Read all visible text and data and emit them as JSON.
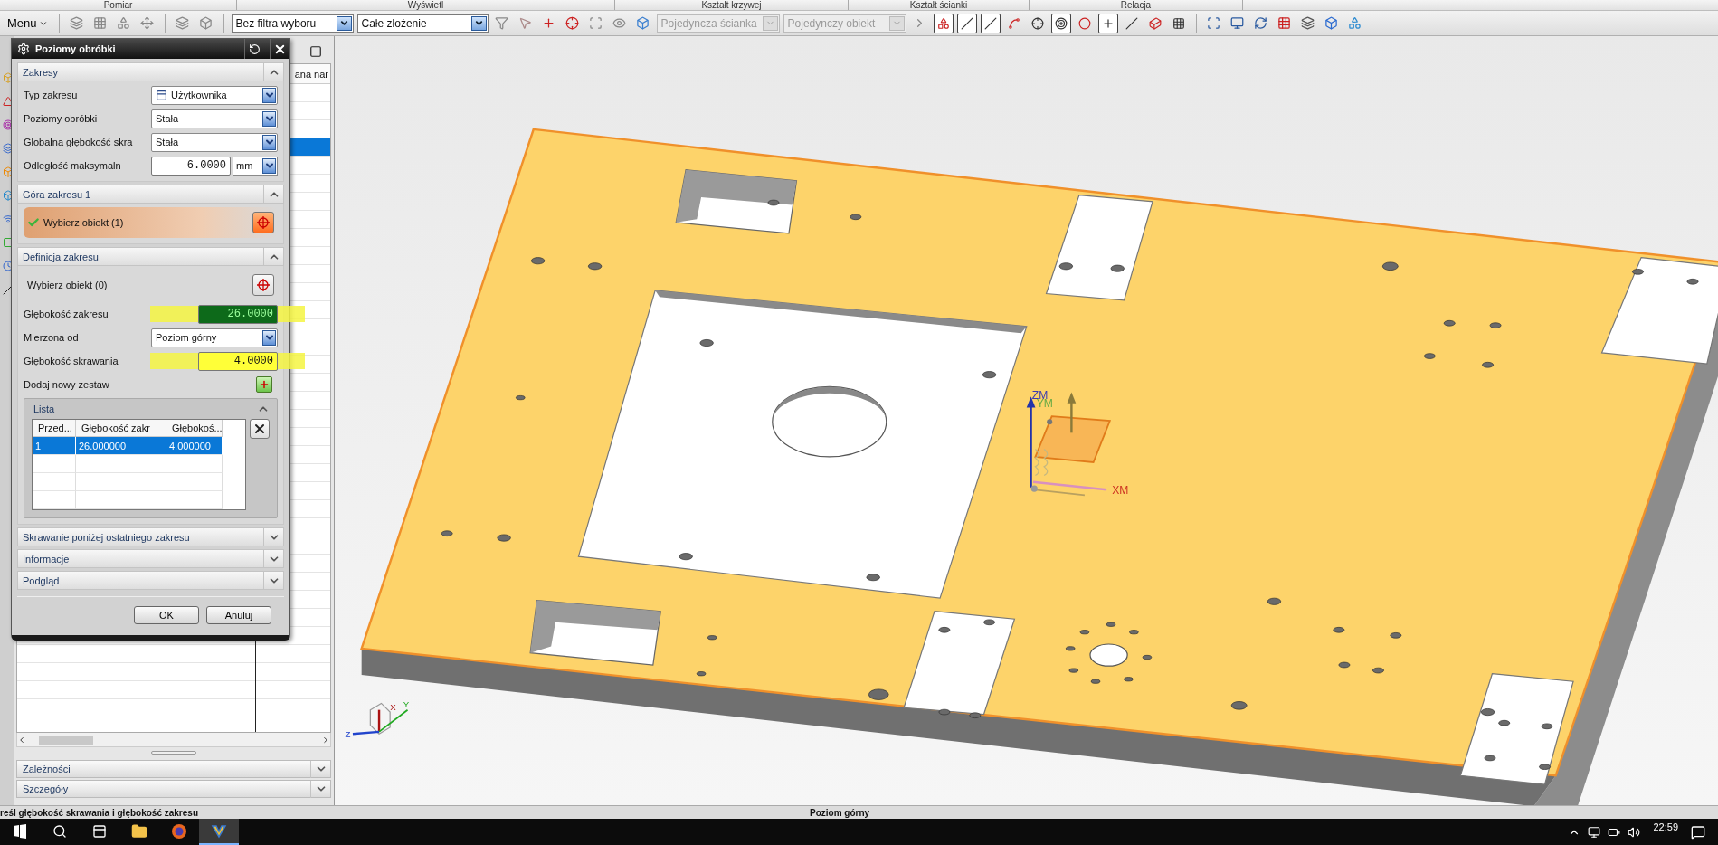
{
  "ribbon_groups": [
    "Pomiar",
    "Wyświetl",
    "Kształt krzywej",
    "Kształt ścianki",
    "Relacja"
  ],
  "toolbar": {
    "menu": "Menu",
    "selection_filter": "Bez filtra wyboru",
    "scope": "Całe złożenie",
    "face_rule": "Pojedyncza ścianka",
    "curve_rule": "Pojedynczy obiekt",
    "snap_buttons": [
      {
        "on": true
      },
      {
        "on": true
      },
      {
        "on": true
      },
      {
        "on": false
      },
      {
        "on": false
      },
      {
        "on": true
      },
      {
        "on": false
      },
      {
        "on": true
      },
      {
        "on": false
      },
      {
        "on": false
      },
      {
        "on": false
      }
    ]
  },
  "navigator": {
    "column_header": "ana nar",
    "rows": [
      {
        "selected": false
      },
      {
        "selected": false
      },
      {
        "selected": false
      },
      {
        "selected": true
      },
      {
        "selected": false
      },
      {
        "selected": false
      },
      {
        "selected": false
      },
      {
        "selected": false
      },
      {
        "selected": false
      },
      {
        "selected": false
      },
      {
        "selected": false
      },
      {
        "selected": false
      },
      {
        "selected": false
      },
      {
        "selected": false
      },
      {
        "selected": false
      },
      {
        "selected": false
      },
      {
        "selected": false
      },
      {
        "selected": false
      },
      {
        "selected": false
      },
      {
        "selected": false
      },
      {
        "selected": false
      },
      {
        "selected": false
      },
      {
        "selected": false
      },
      {
        "selected": false
      },
      {
        "selected": false
      },
      {
        "selected": false
      },
      {
        "selected": false
      },
      {
        "selected": false
      },
      {
        "selected": false
      },
      {
        "selected": false
      },
      {
        "selected": false
      },
      {
        "selected": false
      },
      {
        "selected": false
      },
      {
        "selected": false
      },
      {
        "selected": false
      }
    ],
    "sections": [
      {
        "title": "Zależności",
        "expanded": false
      },
      {
        "title": "Szczegóły",
        "expanded": false
      }
    ]
  },
  "dialog": {
    "title": "Poziomy obróbki",
    "sections": [
      {
        "title": "Zakresy",
        "expanded": true,
        "fields": [
          {
            "kind": "select_icon",
            "label": "Typ zakresu",
            "value": "Użytkownika"
          },
          {
            "kind": "select",
            "label": "Poziomy obróbki",
            "value": "Stała"
          },
          {
            "kind": "select",
            "label": "Globalna głębokość skra",
            "value": "Stała"
          },
          {
            "kind": "number_unit",
            "label": "Odległość maksymaln",
            "value": "6.0000",
            "unit": "mm"
          }
        ]
      },
      {
        "title": "Góra zakresu 1",
        "expanded": true,
        "fields": [
          {
            "kind": "picker",
            "label": "Wybierz obiekt (1)",
            "checked": true,
            "selected": true
          }
        ]
      },
      {
        "title": "Definicja zakresu",
        "expanded": true,
        "fields": [
          {
            "kind": "picker",
            "label": "Wybierz obiekt (0)",
            "checked": false,
            "selected": false
          },
          {
            "kind": "number",
            "label": "Głębokość zakresu",
            "value": "26.0000",
            "focused": true,
            "highlighted": true
          },
          {
            "kind": "select",
            "label": "Mierzona od",
            "value": "Poziom górny"
          },
          {
            "kind": "number",
            "label": "Głębokość skrawania",
            "value": "4.0000",
            "focused": false,
            "highlighted": true
          },
          {
            "kind": "add",
            "label": "Dodaj nowy zestaw"
          }
        ],
        "list": {
          "title": "Lista",
          "expanded": true,
          "columns": [
            "Przed...",
            "Głębokość zakr",
            "Głębokoś..."
          ],
          "rows": [
            {
              "cells": [
                "1",
                "26.000000",
                "4.000000"
              ],
              "selected": true
            }
          ]
        }
      },
      {
        "title": "Skrawanie poniżej ostatniego zakresu",
        "expanded": false
      },
      {
        "title": "Informacje",
        "expanded": false
      },
      {
        "title": "Podgląd",
        "expanded": false
      }
    ],
    "buttons": [
      "OK",
      "Anuluj"
    ]
  },
  "viewport": {
    "wcs_labels": [
      "ZM",
      "YM",
      "XM"
    ],
    "view_triad_labels": [
      "X",
      "Y",
      "Z"
    ]
  },
  "status_bar": {
    "prompt": "reśl głębokość skrawania i głębokość zakresu",
    "selection": "Poziom górny"
  },
  "taskbar": {
    "time": "22:59"
  }
}
